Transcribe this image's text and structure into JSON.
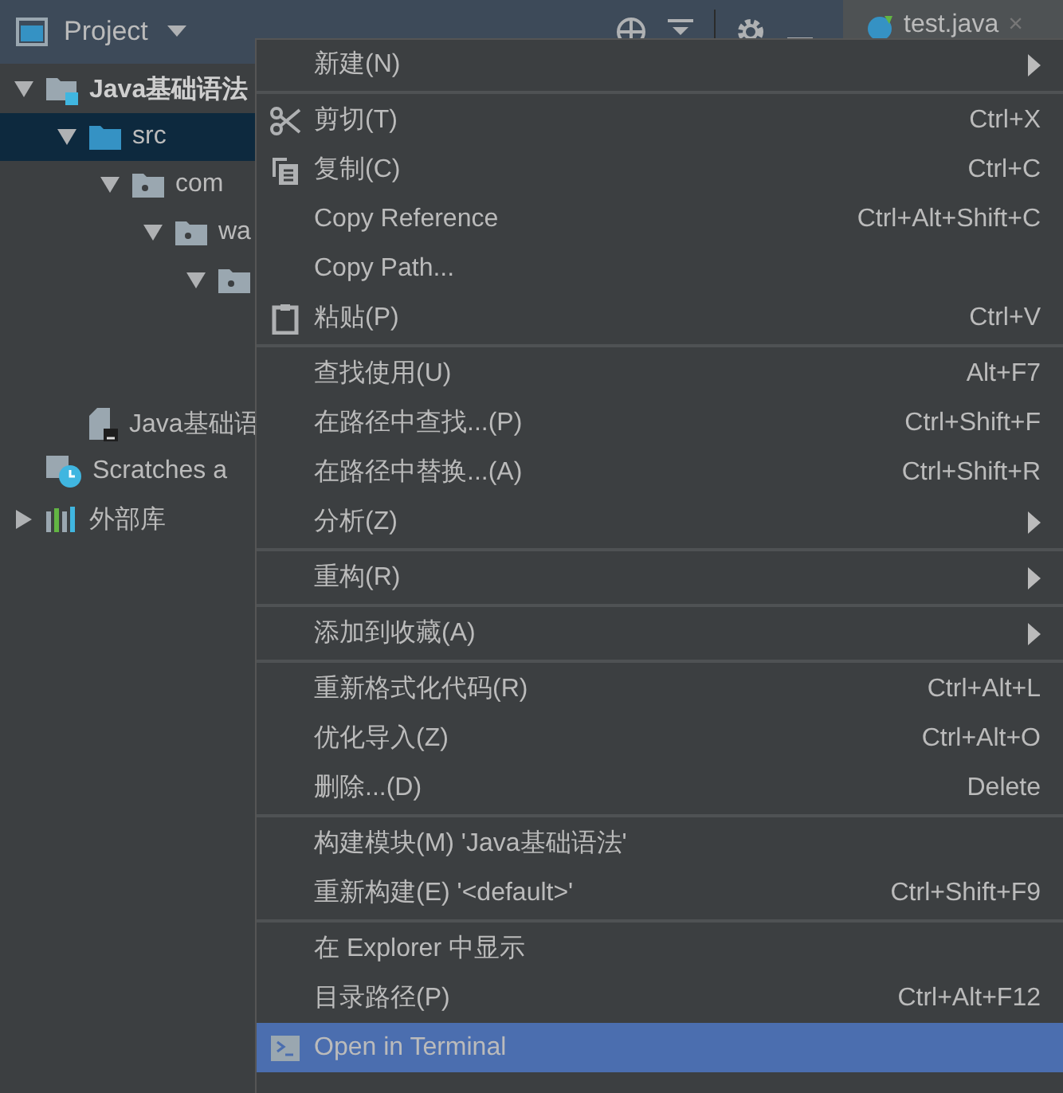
{
  "toolbar": {
    "title": "Project",
    "editor_tab": {
      "label": "test.java",
      "close": "×"
    }
  },
  "tree": [
    {
      "label": "Java基础语法",
      "kind": "module",
      "expanded": true,
      "selected": false,
      "children": [
        {
          "label": "src",
          "kind": "source",
          "expanded": true,
          "selected": true,
          "children": [
            {
              "label": "com",
              "kind": "package",
              "expanded": true,
              "selected": false,
              "children": [
                {
                  "label": "wa",
                  "kind": "package",
                  "expanded": true,
                  "selected": false,
                  "children": [
                    {
                      "kind": "package",
                      "expanded": true,
                      "selected": false
                    }
                  ]
                }
              ]
            }
          ]
        },
        {
          "label": "Java基础语",
          "kind": "file",
          "selected": false
        }
      ]
    },
    {
      "label": "Scratches a",
      "kind": "scratches",
      "selected": false
    },
    {
      "label": "外部库",
      "kind": "library",
      "expanded": false,
      "selected": false
    }
  ],
  "context_menu": {
    "groups": [
      [
        {
          "label": "新建(N)",
          "kind": "plain",
          "submenu": true,
          "selected": false
        }
      ],
      [
        {
          "label": "剪切(T)",
          "kind": "cut",
          "shortcut": "Ctrl+X",
          "submenu": false,
          "selected": false
        },
        {
          "label": "复制(C)",
          "kind": "copy",
          "shortcut": "Ctrl+C",
          "submenu": false,
          "selected": false
        },
        {
          "label": "Copy Reference",
          "kind": "plain",
          "shortcut": "Ctrl+Alt+Shift+C",
          "submenu": false,
          "selected": false
        },
        {
          "label": "Copy Path...",
          "kind": "plain",
          "submenu": false,
          "selected": false
        },
        {
          "label": "粘贴(P)",
          "kind": "paste",
          "shortcut": "Ctrl+V",
          "submenu": false,
          "selected": false
        }
      ],
      [
        {
          "label": "查找使用(U)",
          "kind": "plain",
          "shortcut": "Alt+F7",
          "submenu": false,
          "selected": false
        },
        {
          "label": "在路径中查找...(P)",
          "kind": "plain",
          "shortcut": "Ctrl+Shift+F",
          "submenu": false,
          "selected": false
        },
        {
          "label": "在路径中替换...(A)",
          "kind": "plain",
          "shortcut": "Ctrl+Shift+R",
          "submenu": false,
          "selected": false
        },
        {
          "label": "分析(Z)",
          "kind": "plain",
          "submenu": true,
          "selected": false
        }
      ],
      [
        {
          "label": "重构(R)",
          "kind": "plain",
          "submenu": true,
          "selected": false
        }
      ],
      [
        {
          "label": "添加到收藏(A)",
          "kind": "plain",
          "submenu": true,
          "selected": false
        }
      ],
      [
        {
          "label": "重新格式化代码(R)",
          "kind": "plain",
          "shortcut": "Ctrl+Alt+L",
          "submenu": false,
          "selected": false
        },
        {
          "label": "优化导入(Z)",
          "kind": "plain",
          "shortcut": "Ctrl+Alt+O",
          "submenu": false,
          "selected": false
        },
        {
          "label": "删除...(D)",
          "kind": "plain",
          "shortcut": "Delete",
          "submenu": false,
          "selected": false
        }
      ],
      [
        {
          "label": "构建模块(M) 'Java基础语法'",
          "kind": "plain",
          "submenu": false,
          "selected": false
        },
        {
          "label": "重新构建(E) '<default>'",
          "kind": "plain",
          "shortcut": "Ctrl+Shift+F9",
          "submenu": false,
          "selected": false
        }
      ],
      [
        {
          "label": "在 Explorer 中显示",
          "kind": "plain",
          "submenu": false,
          "selected": false
        },
        {
          "label": "目录路径(P)",
          "kind": "plain",
          "shortcut": "Ctrl+Alt+F12",
          "submenu": false,
          "selected": false
        },
        {
          "label": "Open in Terminal",
          "kind": "terminal",
          "submenu": false,
          "selected": true
        }
      ]
    ]
  }
}
